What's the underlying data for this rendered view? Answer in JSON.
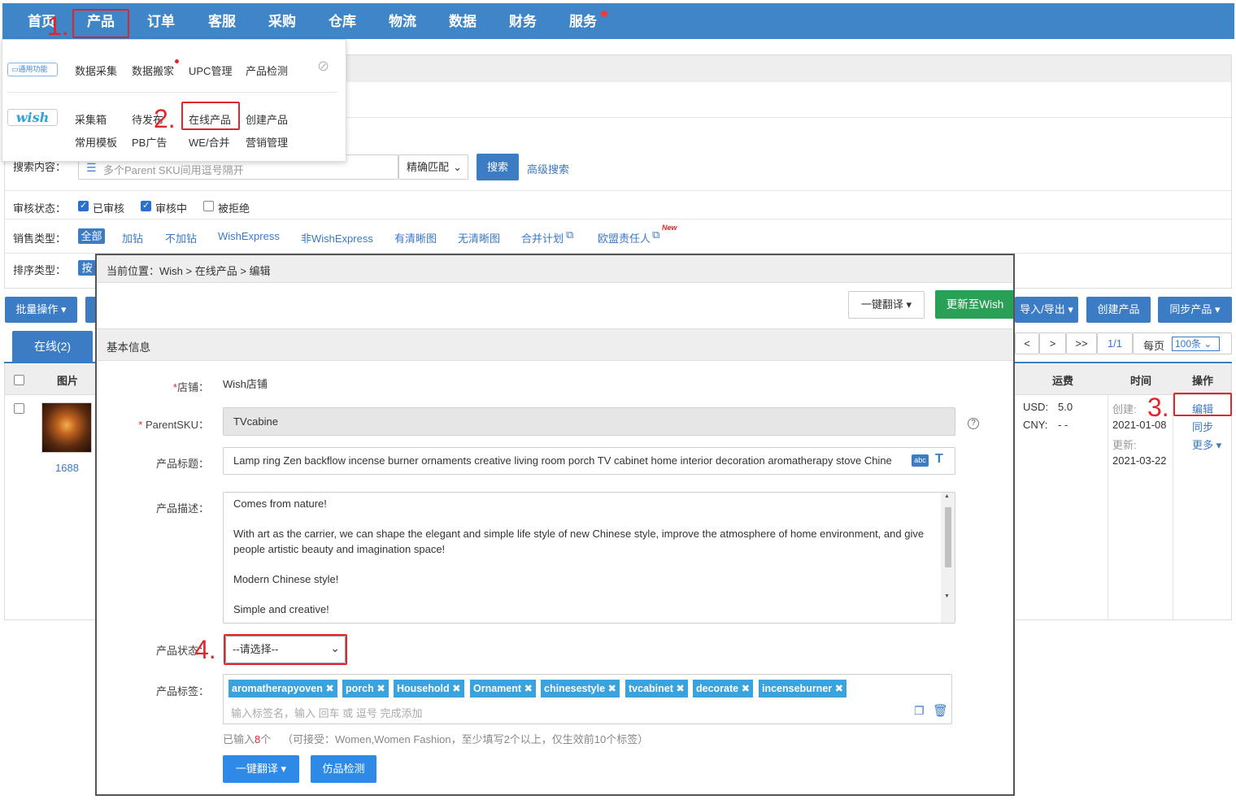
{
  "nav": {
    "items": [
      "首页",
      "产品",
      "订单",
      "客服",
      "采购",
      "仓库",
      "物流",
      "数据",
      "财务",
      "服务"
    ]
  },
  "annotations": [
    "1.",
    "2.",
    "3.",
    "4."
  ],
  "dropdown": {
    "general_badge": "通用功能",
    "general_items": [
      "数据采集",
      "数据搬家",
      "UPC管理",
      "产品检测"
    ],
    "wish_badge": "wish",
    "wish_row1": [
      "采集箱",
      "待发布",
      "在线产品",
      "创建产品"
    ],
    "wish_row2": [
      "常用模板",
      "PB广告",
      "WE/合并",
      "营销管理"
    ]
  },
  "search": {
    "label": "搜索内容：",
    "placeholder": "多个Parent SKU间用逗号隔开",
    "match": "精确匹配",
    "button": "搜索",
    "advanced": "高级搜索"
  },
  "review": {
    "label": "审核状态：",
    "options": [
      {
        "label": "已审核",
        "checked": true
      },
      {
        "label": "审核中",
        "checked": true
      },
      {
        "label": "被拒绝",
        "checked": false
      }
    ]
  },
  "sales": {
    "label": "销售类型：",
    "options": [
      "全部",
      "加钻",
      "不加钻",
      "WishExpress",
      "非WishExpress",
      "有清晰图",
      "无清晰图",
      "合并计划",
      "欧盟责任人"
    ],
    "new_badge": "New"
  },
  "sort": {
    "label": "排序类型：",
    "first": "按"
  },
  "toolbar": {
    "batch": "批量操作 ▾",
    "import_export": "导入/导出 ▾",
    "create": "创建产品",
    "sync": "同步产品 ▾"
  },
  "tabs": {
    "online": "在线(2)"
  },
  "pager": {
    "prev": "<",
    "next": ">",
    "last": ">>",
    "page": "1/1",
    "per_page_label": "每页",
    "per_page": "100条"
  },
  "table": {
    "col_image": "图片",
    "col_shipping": "运费",
    "col_time": "时间",
    "col_action": "操作",
    "image_id": "1688",
    "usd_label": "USD:",
    "usd_value": "5.0",
    "cny_label": "CNY:",
    "cny_value": "- -",
    "created_label": "创建:",
    "created_value": "2021-01-08",
    "updated_label": "更新:",
    "updated_value": "2021-03-22",
    "action_edit": "编辑",
    "action_sync": "同步",
    "action_more": "更多"
  },
  "modal": {
    "breadcrumb": "当前位置：Wish > 在线产品 > 编辑",
    "translate_btn": "一键翻译",
    "update_btn": "更新至Wish",
    "section": "基本信息",
    "store_label": "店铺：",
    "store_value": "Wish店铺",
    "sku_label": "ParentSKU：",
    "sku_value": "TVcabine",
    "title_label": "产品标题：",
    "title_value": "Lamp ring Zen backflow incense burner ornaments creative living room porch TV cabinet home interior decoration aromatherapy stove Chine",
    "desc_label": "产品描述：",
    "desc_lines": [
      "Comes from nature!",
      "With art as the carrier, we can shape the elegant and simple life style of new Chinese style, improve the atmosphere of home environment, and give people artistic beauty and imagination space!",
      "Modern Chinese style!",
      "Simple and creative!"
    ],
    "status_label": "产品状态：",
    "status_value": "--请选择--",
    "tags_label": "产品标签：",
    "tags": [
      "aromatherapyoven",
      "porch",
      "Household",
      "Ornament",
      "chinesestyle",
      "tvcabinet",
      "decorate",
      "incenseburner"
    ],
    "tag_input_placeholder": "输入标签名，输入 回车 或 逗号 完成添加",
    "tag_count_prefix": "已输入",
    "tag_count": "8",
    "tag_count_suffix": "个",
    "tag_hint": "（可接受：Women,Women Fashion，至少填写2个以上，仅生效前10个标签）",
    "bottom_translate": "一键翻译",
    "bottom_check": "仿品检测"
  }
}
